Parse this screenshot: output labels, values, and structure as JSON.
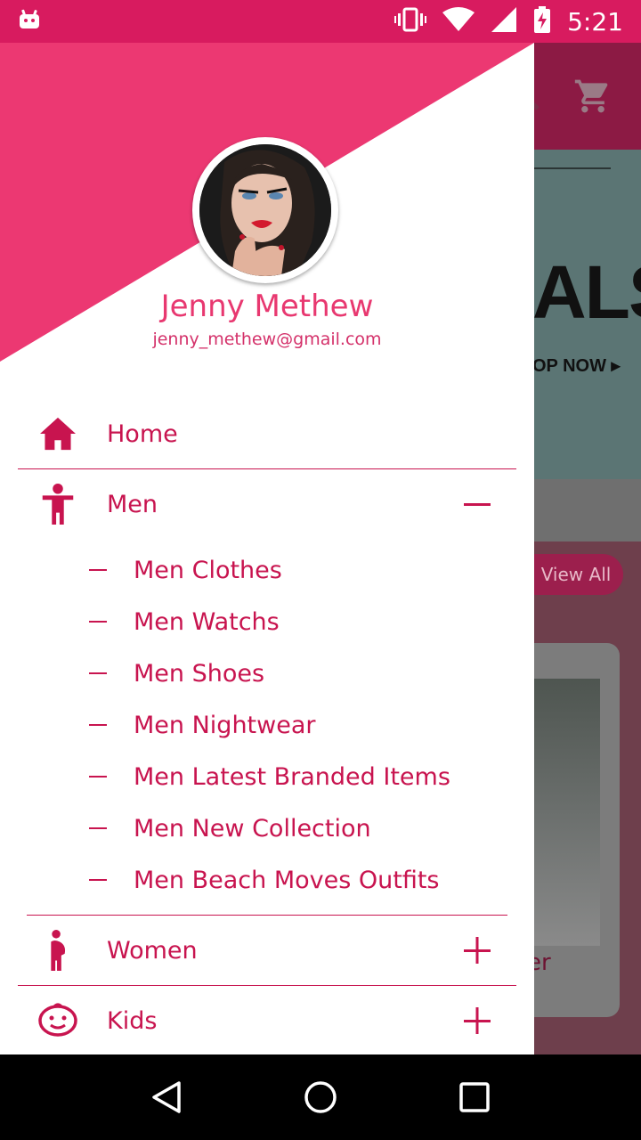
{
  "status_bar": {
    "time": "5:21",
    "icons": [
      "android-icon",
      "vibrate-icon",
      "wifi-icon",
      "cell-signal-icon",
      "battery-charging-icon"
    ]
  },
  "background_app": {
    "banner_text": "ALS",
    "banner_shop": "OP NOW ▸",
    "view_all": "View All",
    "product_partial": "er"
  },
  "drawer": {
    "user": {
      "name": "Jenny Methew",
      "email": "jenny_methew@gmail.com"
    },
    "items": [
      {
        "label": "Home",
        "icon": "home-icon"
      },
      {
        "label": "Men",
        "icon": "person-icon",
        "toggle": "minus-icon",
        "children": [
          "Men Clothes",
          "Men Watchs",
          "Men Shoes",
          "Men Nightwear",
          "Men Latest Branded Items",
          "Men New Collection",
          "Men Beach Moves Outfits"
        ]
      },
      {
        "label": "Women",
        "icon": "pregnant-woman-icon",
        "toggle": "plus-icon"
      },
      {
        "label": "Kids",
        "icon": "child-face-icon",
        "toggle": "plus-icon"
      }
    ]
  },
  "colors": {
    "accent": "#c8144f",
    "header_pink": "#ec3872",
    "status_bar": "#d81b5f"
  }
}
